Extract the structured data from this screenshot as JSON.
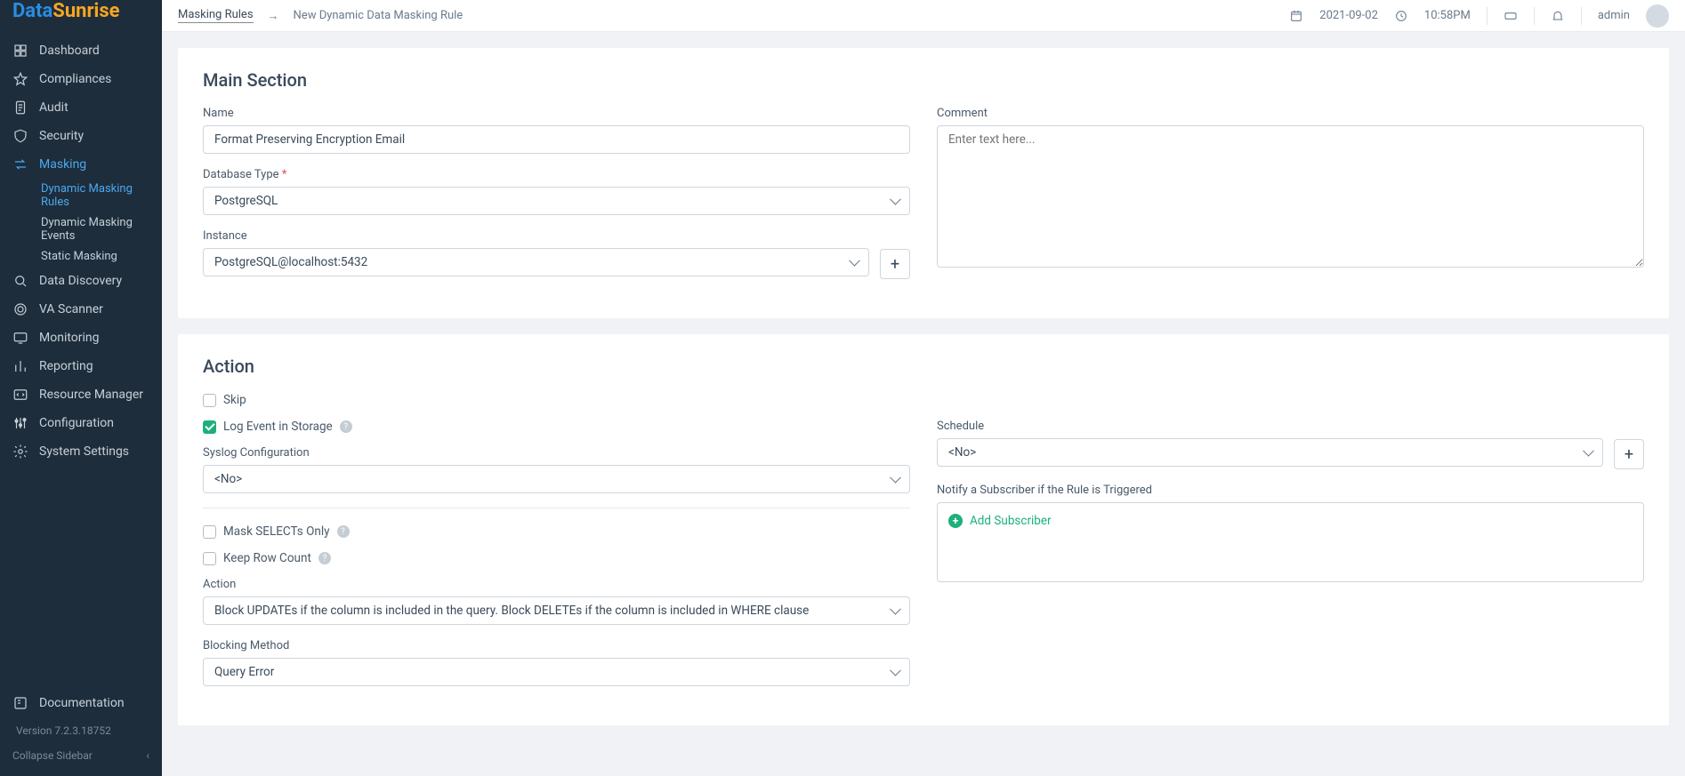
{
  "brand": {
    "part1": "Data",
    "part2": "Sunrise"
  },
  "sidebar": {
    "items": [
      {
        "label": "Dashboard",
        "icon": "grid"
      },
      {
        "label": "Compliances",
        "icon": "star"
      },
      {
        "label": "Audit",
        "icon": "doc"
      },
      {
        "label": "Security",
        "icon": "shield"
      },
      {
        "label": "Masking",
        "icon": "swap",
        "active": true,
        "children": [
          {
            "label": "Dynamic Masking Rules",
            "active": true
          },
          {
            "label": "Dynamic Masking Events"
          },
          {
            "label": "Static Masking"
          }
        ]
      },
      {
        "label": "Data Discovery",
        "icon": "search"
      },
      {
        "label": "VA Scanner",
        "icon": "target"
      },
      {
        "label": "Monitoring",
        "icon": "monitor"
      },
      {
        "label": "Reporting",
        "icon": "bars"
      },
      {
        "label": "Resource Manager",
        "icon": "code"
      },
      {
        "label": "Configuration",
        "icon": "sliders"
      },
      {
        "label": "System Settings",
        "icon": "gear"
      }
    ],
    "doc": "Documentation",
    "version": "Version 7.2.3.18752",
    "collapse": "Collapse Sidebar"
  },
  "topbar": {
    "crumb1": "Masking Rules",
    "arrow": "→",
    "crumb2": "New Dynamic Data Masking Rule",
    "date": "2021-09-02",
    "time": "10:58PM",
    "user": "admin"
  },
  "mainSection": {
    "title": "Main Section",
    "name_label": "Name",
    "name_value": "Format Preserving Encryption Email",
    "dbtype_label": "Database Type ",
    "dbtype_value": "PostgreSQL",
    "instance_label": "Instance",
    "instance_value": "PostgreSQL@localhost:5432",
    "comment_label": "Comment",
    "comment_placeholder": "Enter text here..."
  },
  "actionSection": {
    "title": "Action",
    "skip": "Skip",
    "log": "Log Event in Storage",
    "syslog_label": "Syslog Configuration",
    "syslog_value": "<No>",
    "mask_selects": "Mask SELECTs Only",
    "keep_row": "Keep Row Count",
    "action_label": "Action",
    "action_value": "Block UPDATEs if the column is included in the query. Block DELETEs if the column is included in WHERE clause",
    "blocking_label": "Blocking Method",
    "blocking_value": "Query Error",
    "schedule_label": "Schedule",
    "schedule_value": "<No>",
    "notify_label": "Notify a Subscriber if the Rule is Triggered",
    "add_sub": "Add Subscriber"
  }
}
